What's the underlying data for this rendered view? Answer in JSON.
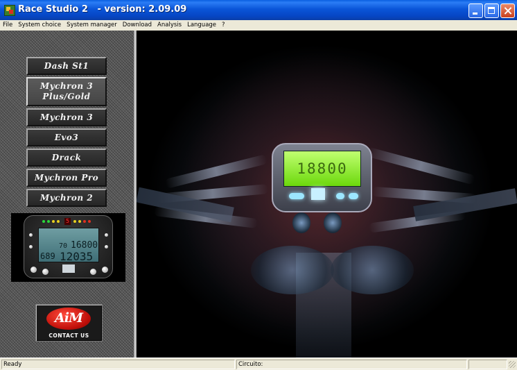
{
  "window": {
    "title": "Race Studio 2   - version: 2.09.09"
  },
  "menu": {
    "items": [
      "File",
      "System choice",
      "System manager",
      "Download",
      "Analysis",
      "Language",
      "?"
    ]
  },
  "sidebar": {
    "systems": [
      {
        "label": "Dash St1",
        "selected": false
      },
      {
        "label": "Mychron 3 Plus/Gold",
        "selected": true
      },
      {
        "label": "Mychron 3",
        "selected": false
      },
      {
        "label": "Evo3",
        "selected": false
      },
      {
        "label": "Drack",
        "selected": false
      },
      {
        "label": "Mychron Pro",
        "selected": false
      },
      {
        "label": "Mychron 2",
        "selected": false
      }
    ],
    "preview": {
      "shift_digit": "5",
      "lcd_rpm": "16800",
      "lcd_speed": "70",
      "lcd_left": "689",
      "lcd_right": "12035"
    },
    "contact": {
      "logo_text": "AiM",
      "label": "CONTACT US"
    }
  },
  "hero": {
    "lcd_text": "18800"
  },
  "statusbar": {
    "status": "Ready",
    "circuit_label": "Circuito:"
  },
  "colors": {
    "title_bar": "#0a55d8",
    "sidebar_bg": "#5a5a5a",
    "button_bg": "#2e2e2e",
    "lcd_green": "#8ef02a",
    "accent_red": "#c0100a"
  }
}
